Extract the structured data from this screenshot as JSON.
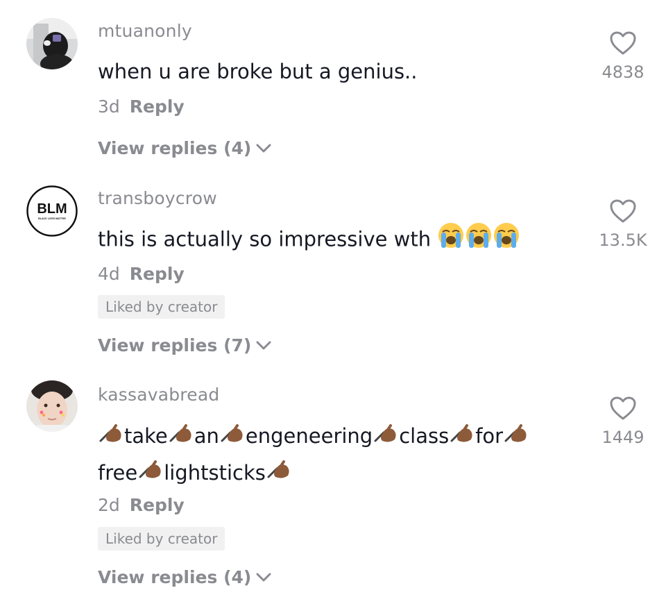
{
  "comments": [
    {
      "username": "mtuanonly",
      "text_parts": [
        "when u are broke but a genius.."
      ],
      "age": "3d",
      "reply_label": "Reply",
      "badge": "",
      "view_replies": "View replies (4)",
      "likes": "4838",
      "avatar": "photo-hooded-figure"
    },
    {
      "username": "transboycrow",
      "text_parts": [
        "this is actually so impressive wth"
      ],
      "age": "4d",
      "reply_label": "Reply",
      "badge": "Liked by creator",
      "view_replies": "View replies (7)",
      "likes": "13.5K",
      "avatar": "blm-logo",
      "avatar_text": "BLM",
      "avatar_subtext": "BLACK LIVES MATTER"
    },
    {
      "username": "kassavabread",
      "text_line1": [
        "take",
        "an",
        "engeneering",
        "class",
        "for"
      ],
      "text_line2": [
        "free",
        "lightsticks"
      ],
      "age": "2d",
      "reply_label": "Reply",
      "badge": "Liked by creator",
      "view_replies": "View replies (4)",
      "likes": "1449",
      "avatar": "photo-face-with-stickers"
    }
  ],
  "icons": {
    "like": "heart-outline-icon",
    "expand": "chevron-down-icon",
    "emoji_1": "loudly-crying-face-emoji",
    "emoji_2": "writing-hand-emoji"
  },
  "colors": {
    "primary_text": "#161823",
    "secondary_text": "#8a8b91",
    "badge_bg": "#f1f1f2"
  }
}
